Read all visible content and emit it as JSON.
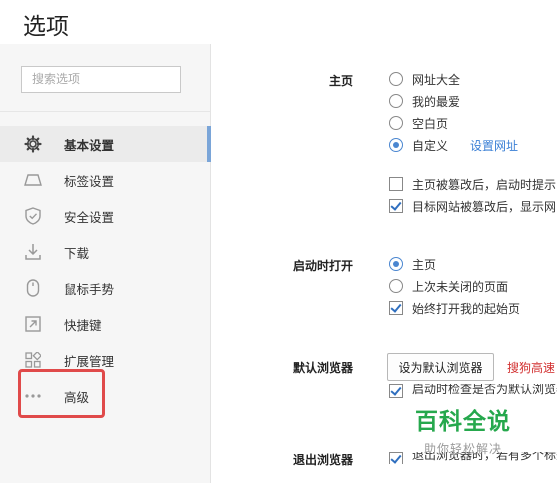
{
  "header": {
    "title": "选项"
  },
  "sidebar": {
    "search_placeholder": "搜索选项",
    "items": [
      {
        "label": "基本设置",
        "icon": "gear-icon",
        "active": true
      },
      {
        "label": "标签设置",
        "icon": "tab-icon"
      },
      {
        "label": "安全设置",
        "icon": "shield-check-icon"
      },
      {
        "label": "下载",
        "icon": "download-icon"
      },
      {
        "label": "鼠标手势",
        "icon": "mouse-icon"
      },
      {
        "label": "快捷键",
        "icon": "shortcut-arrow-icon"
      },
      {
        "label": "扩展管理",
        "icon": "extensions-grid-icon"
      },
      {
        "label": "高级",
        "icon": "more-dots-icon",
        "highlighted": true
      }
    ]
  },
  "colors": {
    "accent": "#4a86d0",
    "link": "#3a7fd5",
    "highlight_border": "#e04a4a",
    "warning_text": "#d23030",
    "watermark": "#26a84d"
  },
  "main": {
    "homepage": {
      "label": "主页",
      "options": [
        {
          "label": "网址大全",
          "selected": false
        },
        {
          "label": "我的最爱",
          "selected": false
        },
        {
          "label": "空白页",
          "selected": false
        },
        {
          "label": "自定义",
          "selected": true
        }
      ],
      "set_url_link": "设置网址",
      "checkboxes": [
        {
          "label": "主页被篡改后，启动时提示",
          "checked": false
        },
        {
          "label": "目标网站被篡改后，显示网",
          "checked": true
        }
      ]
    },
    "startup": {
      "label": "启动时打开",
      "options": [
        {
          "label": "主页",
          "selected": true
        },
        {
          "label": "上次未关闭的页面",
          "selected": false
        }
      ],
      "checkbox": {
        "label": "始终打开我的起始页",
        "checked": true
      }
    },
    "default_browser": {
      "label": "默认浏览器",
      "button": "设为默认浏览器",
      "note": "搜狗高速",
      "partial_checkbox": "启动时检查是否为默认浏览器"
    },
    "exit_browser": {
      "label": "退出浏览器",
      "partial_checkbox": "退出浏览器时，若有多个标签"
    }
  },
  "watermark": {
    "main": "百科全说",
    "sub": "助你轻松解决"
  }
}
